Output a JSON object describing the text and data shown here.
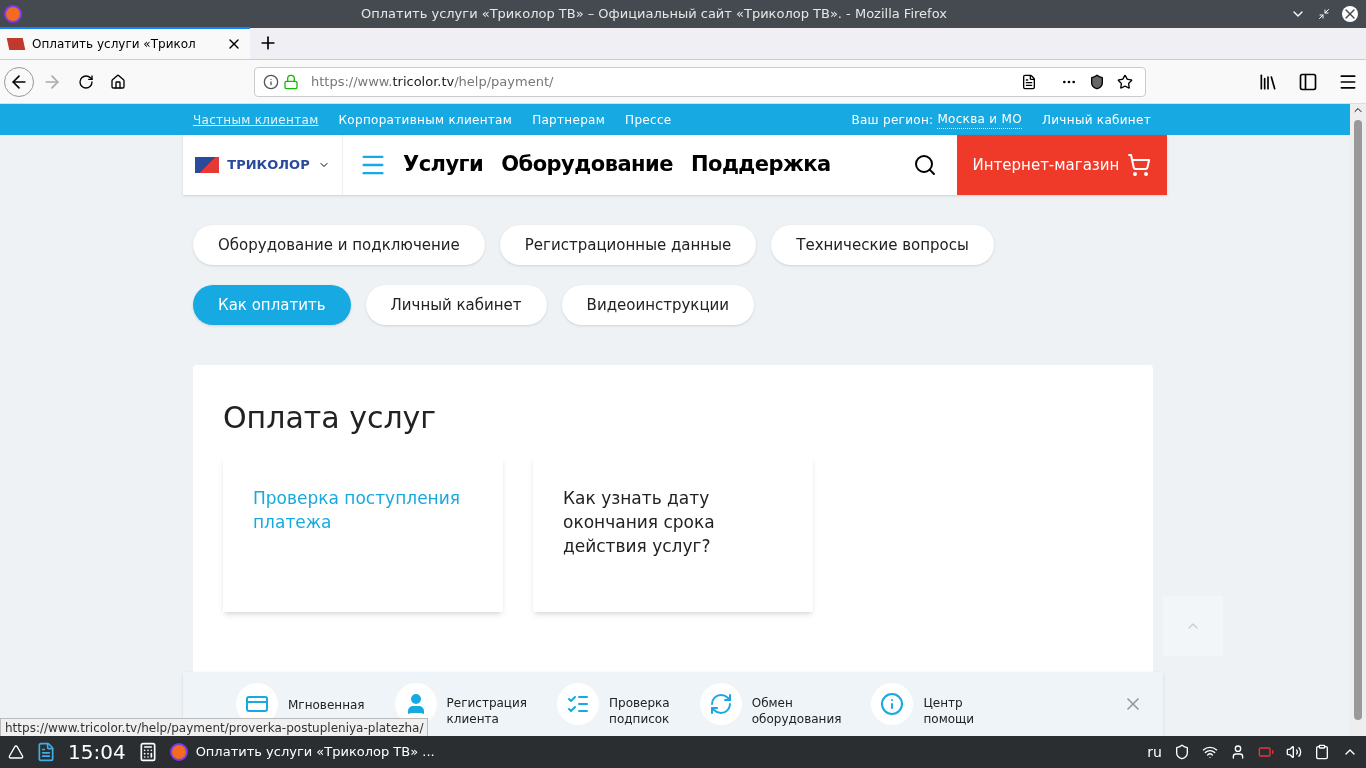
{
  "window": {
    "title": "Оплатить услуги «Триколор ТВ» – Официальный сайт «Триколор ТВ». - Mozilla Firefox"
  },
  "browser_tabs": [
    {
      "label": "Оплатить услуги «Трикол",
      "selected": true
    }
  ],
  "address": {
    "prefix": "https://www.",
    "domain": "tricolor.tv",
    "path": "/help/payment/"
  },
  "topbar": {
    "links": [
      {
        "label": "Частным клиентам",
        "selected": true
      },
      {
        "label": "Корпоративным клиентам",
        "selected": false
      },
      {
        "label": "Партнерам",
        "selected": false
      },
      {
        "label": "Прессе",
        "selected": false
      }
    ],
    "region_label": "Ваш регион:",
    "region": "Москва и МО",
    "cabinet": "Личный кабинет"
  },
  "header": {
    "logo": "ТРИКОЛОР",
    "nav": [
      "Услуги",
      "Оборудование",
      "Поддержка"
    ],
    "shop": "Интернет-магазин"
  },
  "categories": [
    [
      {
        "label": "Оборудование и подключение",
        "selected": false
      },
      {
        "label": "Регистрационные данные",
        "selected": false
      },
      {
        "label": "Технические вопросы",
        "selected": false
      }
    ],
    [
      {
        "label": "Как оплатить",
        "selected": true
      },
      {
        "label": "Личный кабинет",
        "selected": false
      },
      {
        "label": "Видеоинструкции",
        "selected": false
      }
    ]
  ],
  "section": {
    "title": "Оплата услуг",
    "cards": [
      {
        "title": "Проверка поступления платежа",
        "hovered": true
      },
      {
        "title": "Как узнать дату окончания срока действия услуг?",
        "hovered": false
      }
    ]
  },
  "quickbar": [
    {
      "kind": "card",
      "lines": [
        "Мгновенная"
      ]
    },
    {
      "kind": "person",
      "lines": [
        "Регистрация",
        "клиента"
      ]
    },
    {
      "kind": "list",
      "lines": [
        "Проверка",
        "подписок"
      ]
    },
    {
      "kind": "exchange",
      "lines": [
        "Обмен",
        "оборудования"
      ]
    },
    {
      "kind": "info",
      "lines": [
        "Центр",
        "помощи"
      ]
    }
  ],
  "status_url": "https://www.tricolor.tv/help/payment/proverka-postupleniya-platezha/",
  "taskbar": {
    "time": "15:04",
    "task": "Оплатить услуги «Триколор ТВ» ...",
    "lang": "ru"
  }
}
